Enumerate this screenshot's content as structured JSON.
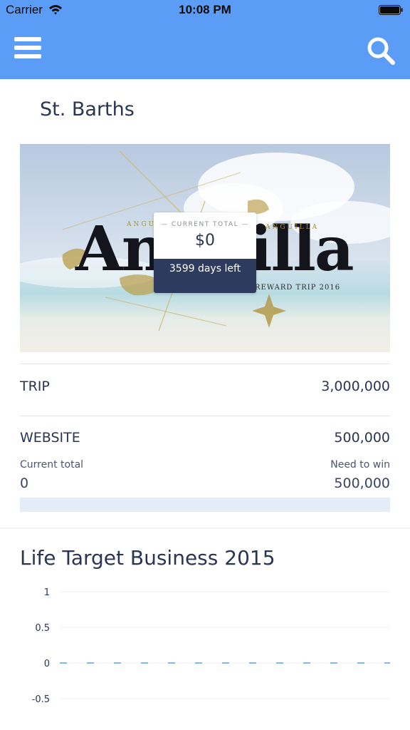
{
  "status_bar": {
    "carrier": "Carrier",
    "time": "10:08 PM"
  },
  "navbar": {
    "menu_icon": "hamburger-menu-icon",
    "search_icon": "search-icon",
    "background": "#5b9cf7"
  },
  "card": {
    "title": "St. Barths",
    "banner": {
      "title": "Anguilla",
      "subtitle": "REWARD TRIP 2016",
      "script_left": "ANGUILLA",
      "script_right": "ANGUILLA"
    },
    "current_total": {
      "label": "CURRENT TOTAL",
      "value": "$0",
      "days_left": "3599 days left"
    }
  },
  "rows": {
    "trip": {
      "label": "TRIP",
      "value": "3,000,000"
    },
    "website": {
      "label": "WEBSITE",
      "value": "500,000"
    }
  },
  "totals": {
    "current_label": "Current total",
    "current_value": "0",
    "need_label": "Need to win",
    "need_value": "500,000",
    "progress": 0
  },
  "chart_section": {
    "title": "Life Target Business 2015"
  },
  "chart_data": {
    "type": "line",
    "title": "Life Target Business 2015",
    "xlabel": "",
    "ylabel": "",
    "y_ticks": [
      "1",
      "0.5",
      "0",
      "-0.5"
    ],
    "ylim": [
      -0.5,
      1
    ],
    "series": [
      {
        "values": [
          0,
          0,
          0,
          0,
          0,
          0,
          0,
          0,
          0,
          0,
          0,
          0
        ],
        "color": "#5b9cf7",
        "style": "dashed"
      }
    ],
    "grid": true
  }
}
